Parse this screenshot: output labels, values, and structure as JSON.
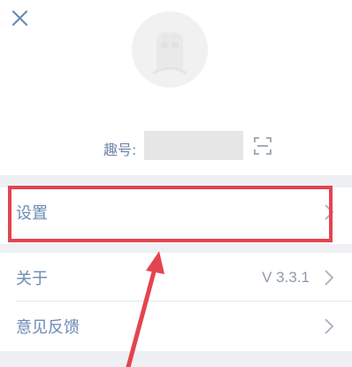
{
  "header": {
    "close_icon": "close-icon"
  },
  "profile": {
    "avatar_icon": "default-avatar-icon",
    "id_label": "趣号:",
    "id_value": "",
    "scan_icon": "scan-icon"
  },
  "menu": {
    "items": [
      {
        "label": "设置",
        "value": ""
      },
      {
        "label": "关于",
        "value": "V 3.3.1"
      },
      {
        "label": "意见反馈",
        "value": ""
      }
    ]
  },
  "colors": {
    "accent_blue": "#6b8bb5",
    "highlight_red": "#e3454f",
    "section_gap": "#eef0f3"
  }
}
